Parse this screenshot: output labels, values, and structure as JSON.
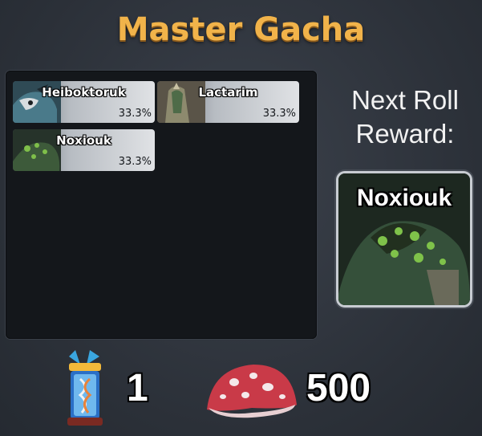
{
  "title": "Master Gacha",
  "pool": [
    {
      "name": "Heiboktoruk",
      "chance": "33.3%"
    },
    {
      "name": "Lactarim",
      "chance": "33.3%"
    },
    {
      "name": "Noxiouk",
      "chance": "33.3%"
    }
  ],
  "next_roll": {
    "label_line1": "Next Roll",
    "label_line2": "Reward:",
    "reward_name": "Noxiouk"
  },
  "currencies": [
    {
      "icon": "gacha-ticket-icon",
      "amount": "1"
    },
    {
      "icon": "mushroom-icon",
      "amount": "500"
    }
  ],
  "colors": {
    "title": "#f1b34a",
    "panel": "#14171b",
    "card_light": "#e0e2e5"
  }
}
